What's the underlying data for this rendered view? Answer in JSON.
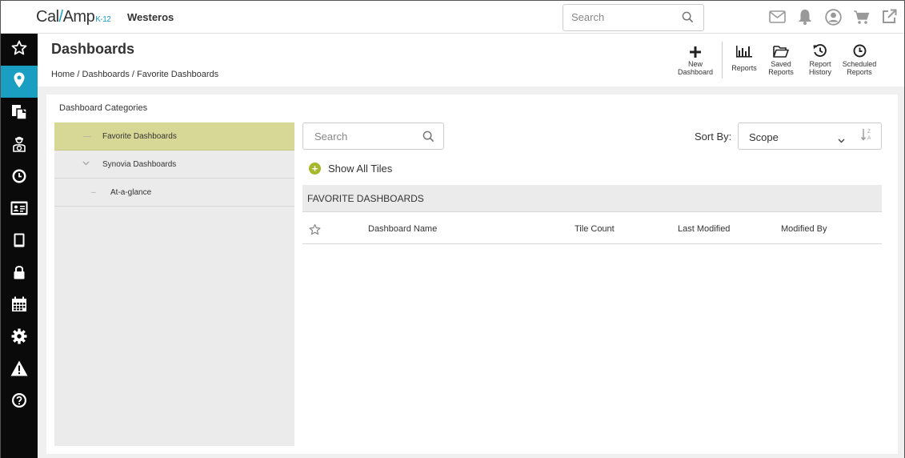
{
  "app": {
    "logo_text": "Cal",
    "logo_text2": "Amp",
    "logo_suffix": "K-12",
    "org_name": "Westeros",
    "search_placeholder": "Search"
  },
  "topbar_icons": [
    "mail-icon",
    "bell-icon",
    "user-icon",
    "cart-icon",
    "external-link-icon"
  ],
  "sidebar": {
    "items": [
      {
        "icon": "star-icon",
        "active": false
      },
      {
        "icon": "map-pin-icon",
        "active": true
      },
      {
        "icon": "documents-icon",
        "active": false
      },
      {
        "icon": "driver-icon",
        "active": false
      },
      {
        "icon": "clock-icon",
        "active": false
      },
      {
        "icon": "id-card-icon",
        "active": false
      },
      {
        "icon": "tablet-icon",
        "active": false
      },
      {
        "icon": "lock-icon",
        "active": false
      },
      {
        "icon": "calendar-icon",
        "active": false
      },
      {
        "icon": "gear-icon",
        "active": false
      },
      {
        "icon": "warning-icon",
        "active": false
      },
      {
        "icon": "help-icon",
        "active": false
      }
    ]
  },
  "header": {
    "title": "Dashboards",
    "breadcrumb": "Home / Dashboards / Favorite Dashboards",
    "actions": [
      {
        "line1": "New",
        "line2": "Dashboard"
      },
      {
        "line1": "Reports",
        "line2": ""
      },
      {
        "line1": "Saved",
        "line2": "Reports"
      },
      {
        "line1": "Report",
        "line2": "History"
      },
      {
        "line1": "Scheduled",
        "line2": "Reports"
      }
    ]
  },
  "categories": {
    "title": "Dashboard Categories",
    "items": [
      {
        "label": "Favorite Dashboards",
        "selected": true
      },
      {
        "label": "Synovia Dashboards",
        "selected": false
      },
      {
        "label": "At-a-glance",
        "selected": false
      }
    ]
  },
  "main": {
    "search_placeholder": "Search",
    "sort_label": "Sort By:",
    "sort_value": "Scope",
    "show_all_label": "Show All Tiles",
    "section_title": "FAVORITE DASHBOARDS",
    "columns": [
      "Dashboard Name",
      "Tile Count",
      "Last Modified",
      "Modified By"
    ]
  },
  "colors": {
    "accent": "#1a9ec1",
    "selected_category": "#d8d896",
    "plus_green": "#a5b92b",
    "sidebar_bg": "#0a0a0a"
  }
}
